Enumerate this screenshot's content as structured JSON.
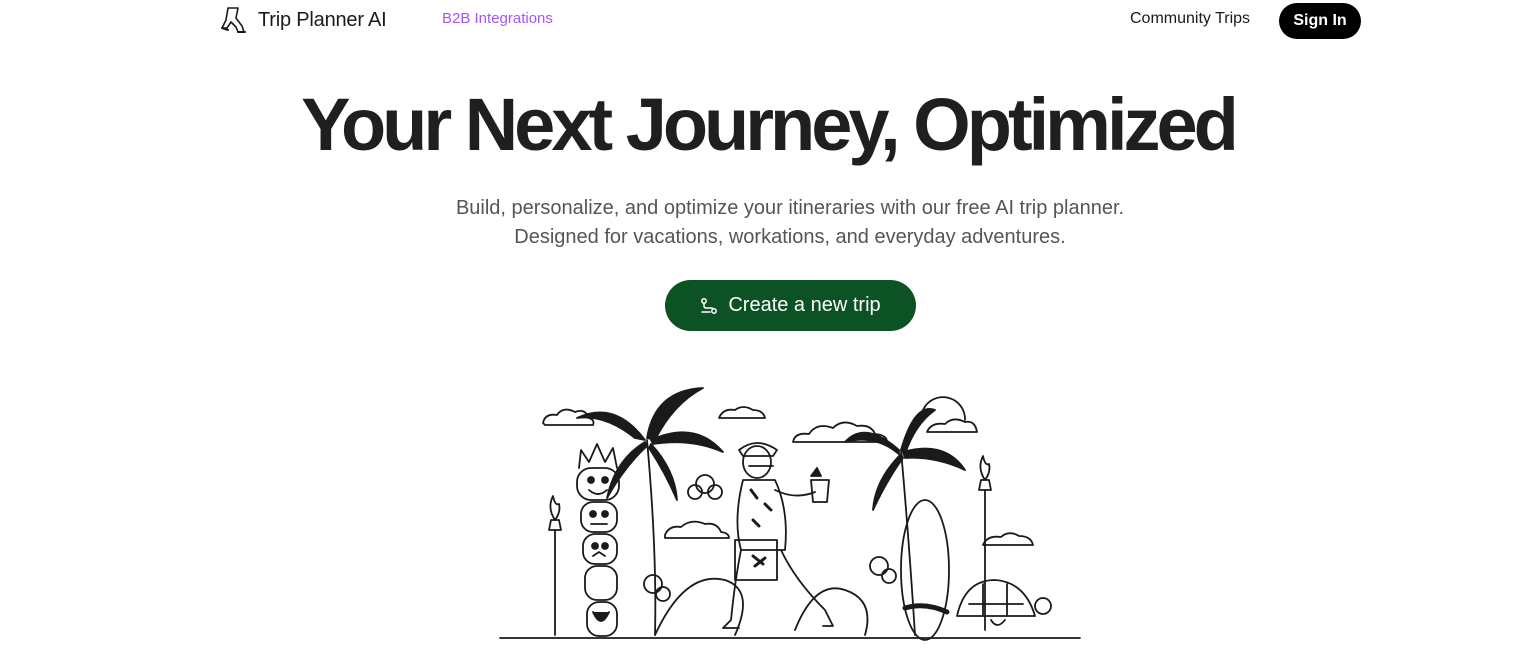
{
  "nav": {
    "logo_text": "Trip Planner AI",
    "b2b_link": "B2B Integrations",
    "community_link": "Community Trips",
    "signin_label": "Sign In"
  },
  "hero": {
    "title": "Your Next Journey, Optimized",
    "subtitle": "Build, personalize, and optimize your itineraries with our free AI trip planner. Designed for vacations, workations, and everyday adventures.",
    "cta_label": "Create a new trip"
  },
  "colors": {
    "accent_purple": "#a855f7",
    "cta_green": "#0d5224",
    "text_dark": "#1f1f1f",
    "text_muted": "#555555"
  },
  "icons": {
    "logo": "walking-legs-icon",
    "cta": "route-icon"
  }
}
